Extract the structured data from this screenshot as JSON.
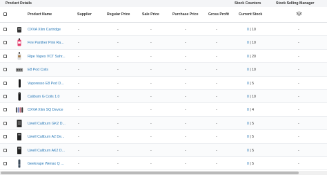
{
  "groups": {
    "product_details": "Product Details",
    "stock_counters": "Stock Counters",
    "stock_selling_manager": "Stock Selling Manager"
  },
  "columns": {
    "product_name": "Product Name",
    "supplier": "Supplier",
    "regular_price": "Regular Price",
    "sale_price": "Sale Price",
    "purchase_price": "Purchase Price",
    "gross_profit": "Gross Profit",
    "current_stock": "Current Stock",
    "settings_icon": "layers-icon"
  },
  "rows": [
    {
      "name": "OXVA Xlim Cartridge",
      "supplier": "-",
      "regular_price": "-",
      "sale_price": "-",
      "purchase_price": "-",
      "gross_profit": "-",
      "stock_link": "0",
      "stock_total": "10",
      "thumb": "cartridge",
      "extra": "-"
    },
    {
      "name": "Fire Panther Pink Ra...",
      "supplier": "-",
      "regular_price": "-",
      "sale_price": "-",
      "purchase_price": "-",
      "gross_profit": "-",
      "stock_link": "0",
      "stock_total": "10",
      "thumb": "bottle",
      "extra": "-"
    },
    {
      "name": "Ripe Vapes VCT Sahr...",
      "supplier": "-",
      "regular_price": "-",
      "sale_price": "-",
      "purchase_price": "-",
      "gross_profit": "-",
      "stock_link": "0",
      "stock_total": "20",
      "thumb": "bottle2",
      "extra": "-"
    },
    {
      "name": "E8 Pod Coils",
      "supplier": "-",
      "regular_price": "-",
      "sale_price": "-",
      "purchase_price": "-",
      "gross_profit": "-",
      "stock_link": "0",
      "stock_total": "10",
      "thumb": "coils",
      "extra": "-"
    },
    {
      "name": "Vaporesso E8 Pod Devi...",
      "supplier": "-",
      "regular_price": "-",
      "sale_price": "-",
      "purchase_price": "-",
      "gross_profit": "-",
      "stock_link": "0",
      "stock_total": "5",
      "thumb": "pen",
      "extra": "-"
    },
    {
      "name": "Caliburn G Coils 1.0",
      "supplier": "-",
      "regular_price": "-",
      "sale_price": "-",
      "purchase_price": "-",
      "gross_profit": "-",
      "stock_link": "0",
      "stock_total": "10",
      "thumb": "pen2",
      "extra": "-"
    },
    {
      "name": "OXVA Xlim SQ Device",
      "supplier": "-",
      "regular_price": "-",
      "sale_price": "-",
      "purchase_price": "-",
      "gross_profit": "-",
      "stock_link": "0",
      "stock_total": "4",
      "thumb": "devices",
      "extra": "-"
    },
    {
      "name": "Uwell Caliburn GK2 D...",
      "supplier": "-",
      "regular_price": "-",
      "sale_price": "-",
      "purchase_price": "-",
      "gross_profit": "-",
      "stock_link": "0",
      "stock_total": "5",
      "thumb": "box",
      "extra": "-"
    },
    {
      "name": "Uwell Caliburn A2 De...",
      "supplier": "-",
      "regular_price": "-",
      "sale_price": "-",
      "purchase_price": "-",
      "gross_profit": "-",
      "stock_link": "0",
      "stock_total": "5",
      "thumb": "mod",
      "extra": "-"
    },
    {
      "name": "Uwell Caliburn AK2 D...",
      "supplier": "-",
      "regular_price": "-",
      "sale_price": "-",
      "purchase_price": "-",
      "gross_profit": "-",
      "stock_link": "0",
      "stock_total": "5",
      "thumb": "mod",
      "extra": "-"
    },
    {
      "name": "Geekvape Wenax Q Dev...",
      "supplier": "-",
      "regular_price": "-",
      "sale_price": "-",
      "purchase_price": "-",
      "gross_profit": "-",
      "stock_link": "0",
      "stock_total": "5",
      "thumb": "pen3",
      "extra": "-"
    }
  ]
}
